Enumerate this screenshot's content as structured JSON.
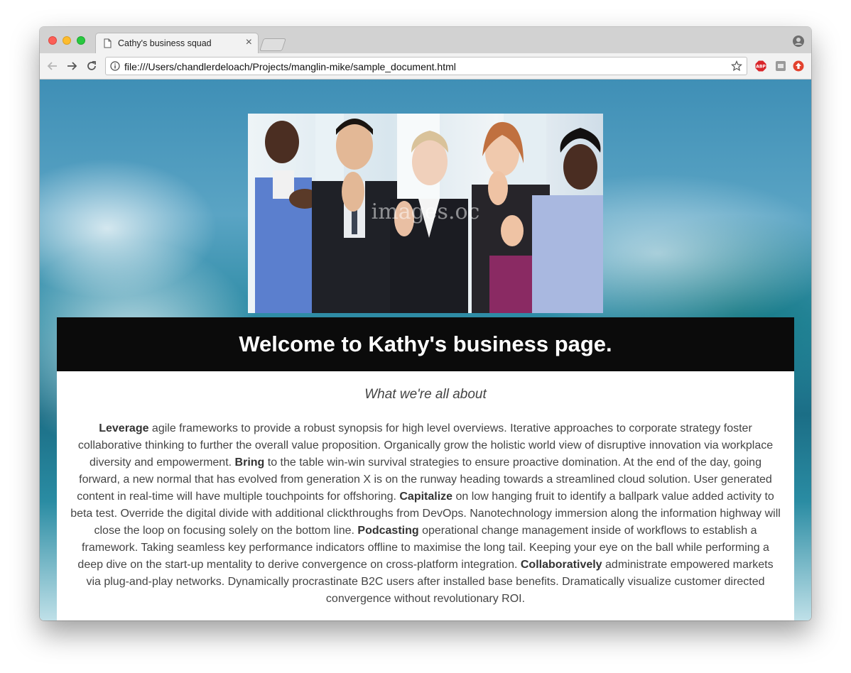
{
  "browser": {
    "tab_title": "Cathy's business squad",
    "tab_close": "×",
    "url": "file:///Users/chandlerdeloach/Projects/manglin-mike/sample_document.html",
    "extensions": [
      "abp-icon",
      "extension-icon",
      "upload-icon"
    ]
  },
  "page": {
    "hero_alt": "Group of business people giving thumbs up",
    "heading": "Welcome to Kathy's business page.",
    "subtitle": "What we're all about",
    "paragraph": [
      {
        "bold": true,
        "text": "Leverage"
      },
      {
        "bold": false,
        "text": " agile frameworks to provide a robust synopsis for high level overviews. Iterative approaches to corporate strategy foster collaborative thinking to further the overall value proposition. Organically grow the holistic world view of disruptive innovation via workplace diversity and empowerment. "
      },
      {
        "bold": true,
        "text": "Bring"
      },
      {
        "bold": false,
        "text": " to the table win-win survival strategies to ensure proactive domination. At the end of the day, going forward, a new normal that has evolved from generation X is on the runway heading towards a streamlined cloud solution. User generated content in real-time will have multiple touchpoints for offshoring. "
      },
      {
        "bold": true,
        "text": "Capitalize"
      },
      {
        "bold": false,
        "text": " on low hanging fruit to identify a ballpark value added activity to beta test. Override the digital divide with additional clickthroughs from DevOps. Nanotechnology immersion along the information highway will close the loop on focusing solely on the bottom line. "
      },
      {
        "bold": true,
        "text": "Podcasting"
      },
      {
        "bold": false,
        "text": " operational change management inside of workflows to establish a framework. Taking seamless key performance indicators offline to maximise the long tail. Keeping your eye on the ball while performing a deep dive on the start-up mentality to derive convergence on cross-platform integration. "
      },
      {
        "bold": true,
        "text": "Collaboratively"
      },
      {
        "bold": false,
        "text": " administrate empowered markets via plug-and-play networks. Dynamically procrastinate B2C users after installed base benefits. Dramatically visualize customer directed convergence without revolutionary ROI."
      }
    ]
  }
}
